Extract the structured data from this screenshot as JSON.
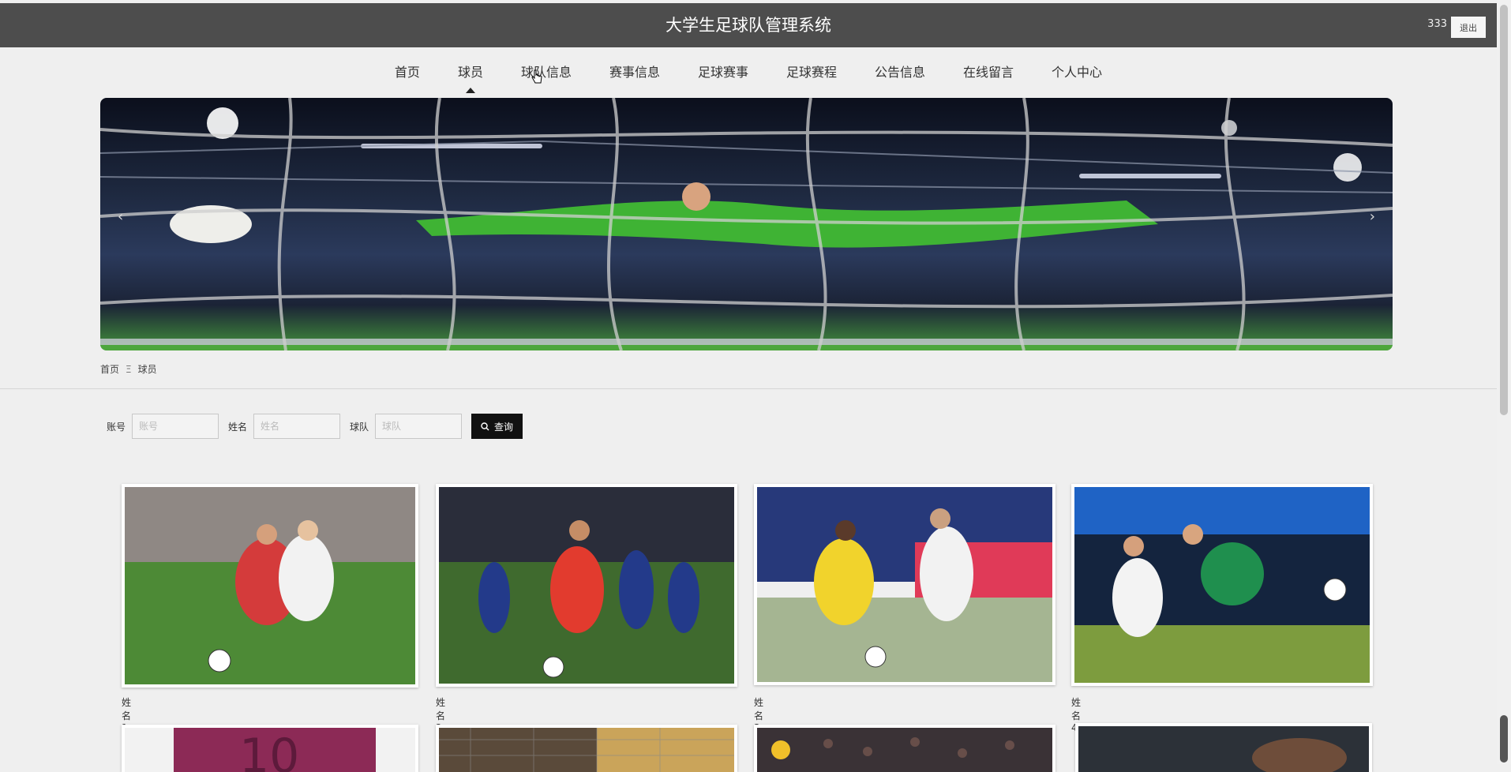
{
  "header": {
    "title": "大学生足球队管理系统",
    "username": "333",
    "logout_label": "退出"
  },
  "nav": {
    "items": [
      "首页",
      "球员",
      "球队信息",
      "赛事信息",
      "足球赛事",
      "足球赛程",
      "公告信息",
      "在线留言",
      "个人中心"
    ],
    "active_index": 1
  },
  "banner": {
    "prev_label": "‹",
    "next_label": "›"
  },
  "breadcrumb": {
    "home": "首页",
    "separator": "Ξ",
    "current": "球员"
  },
  "search": {
    "account_label": "账号",
    "account_placeholder": "账号",
    "name_label": "姓名",
    "name_placeholder": "姓名",
    "team_label": "球队",
    "team_placeholder": "球队",
    "button_label": "查询"
  },
  "players": [
    {
      "name": "姓名1"
    },
    {
      "name": "姓名2"
    },
    {
      "name": "姓名3"
    },
    {
      "name": "姓名4"
    }
  ],
  "colors": {
    "header_bg": "#4d4d4d",
    "search_button": "#111111",
    "background": "#efefef"
  }
}
